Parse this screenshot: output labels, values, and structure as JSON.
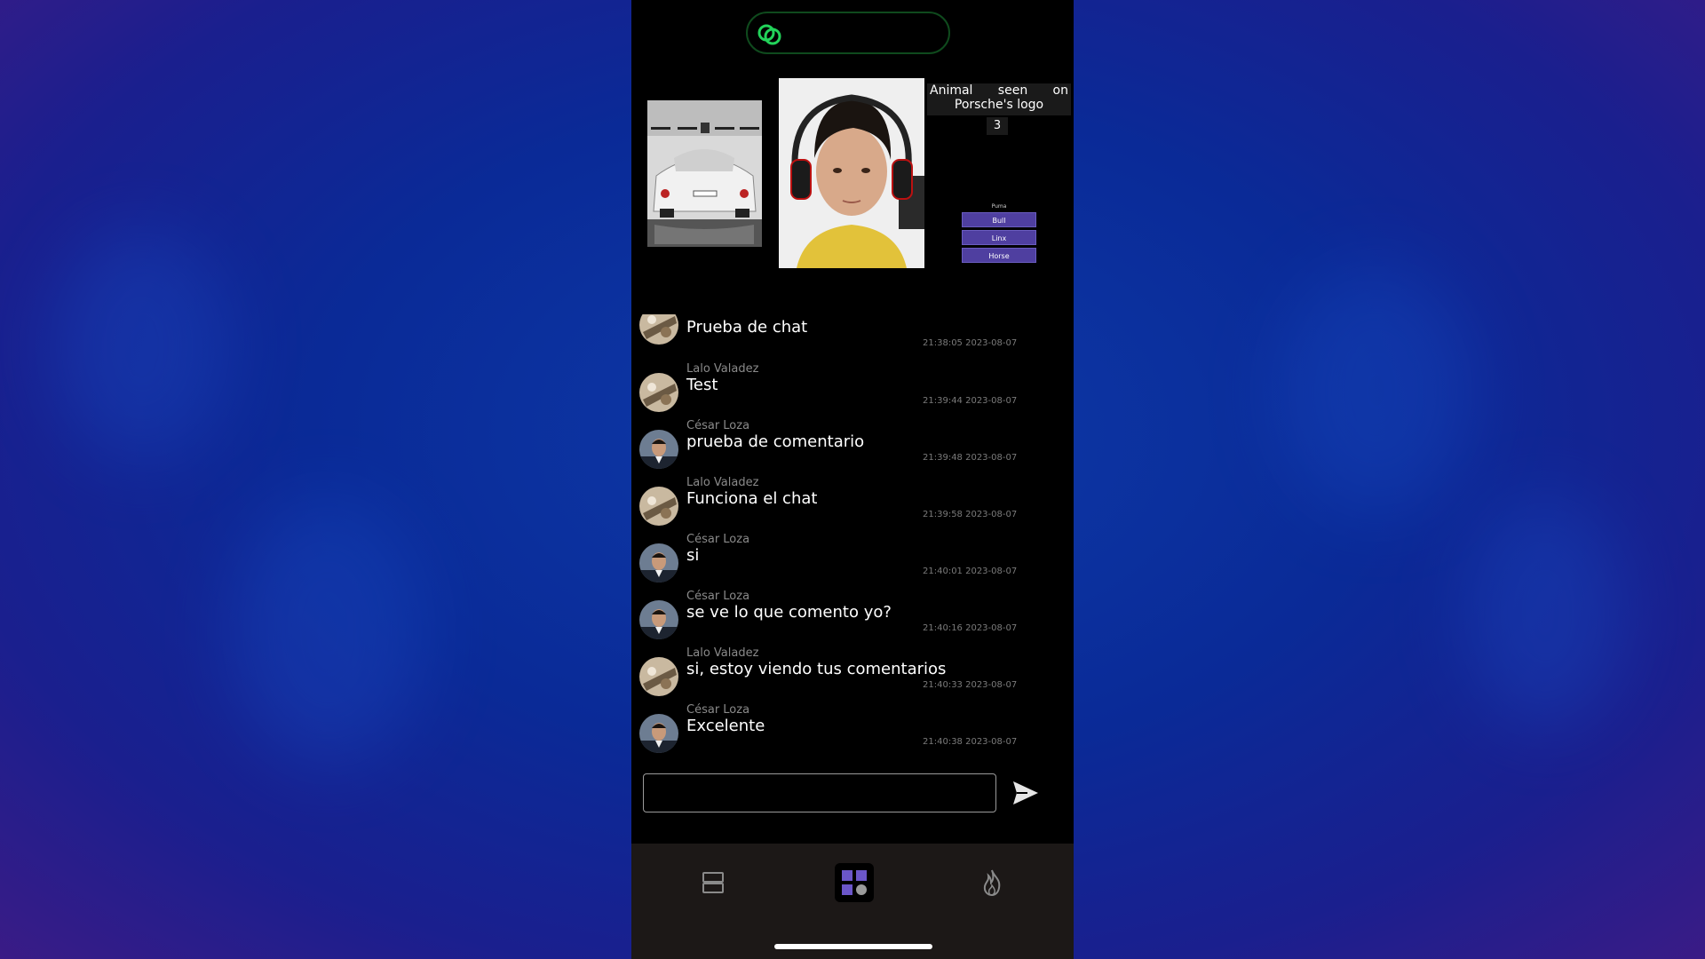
{
  "quiz": {
    "question_line1_words": [
      "Animal",
      "seen",
      "on"
    ],
    "question_line2": "Porsche's logo",
    "count": "3",
    "label": "Puma",
    "options": [
      "Bull",
      "Linx",
      "Horse"
    ]
  },
  "chat": {
    "messages": [
      {
        "author": "",
        "text": "Prueba de chat",
        "time": "21:38:05 2023-08-07",
        "avatar": "lalo"
      },
      {
        "author": "Lalo Valadez",
        "text": "Test",
        "time": "21:39:44 2023-08-07",
        "avatar": "lalo"
      },
      {
        "author": "César Loza",
        "text": "prueba de comentario",
        "time": "21:39:48 2023-08-07",
        "avatar": "cesar"
      },
      {
        "author": "Lalo Valadez",
        "text": "Funciona el chat",
        "time": "21:39:58 2023-08-07",
        "avatar": "lalo"
      },
      {
        "author": "César Loza",
        "text": "si",
        "time": "21:40:01 2023-08-07",
        "avatar": "cesar"
      },
      {
        "author": "César Loza",
        "text": "se ve lo que comento yo?",
        "time": "21:40:16 2023-08-07",
        "avatar": "cesar"
      },
      {
        "author": "Lalo Valadez",
        "text": "si, estoy viendo tus comentarios",
        "time": "21:40:33 2023-08-07",
        "avatar": "lalo"
      },
      {
        "author": "César Loza",
        "text": "Excelente",
        "time": "21:40:38 2023-08-07",
        "avatar": "cesar"
      }
    ],
    "input_value": ""
  },
  "colors": {
    "brand_green": "#22d35a",
    "accent_purple": "#4f3fa0",
    "tab_active_icon": "#6b56c9"
  },
  "icons": {
    "logo": "chain-link-logo-icon",
    "send": "send-arrow-icon",
    "tab_left": "stacked-cards-icon",
    "tab_mid": "grid-apps-icon",
    "tab_right": "flame-icon"
  }
}
